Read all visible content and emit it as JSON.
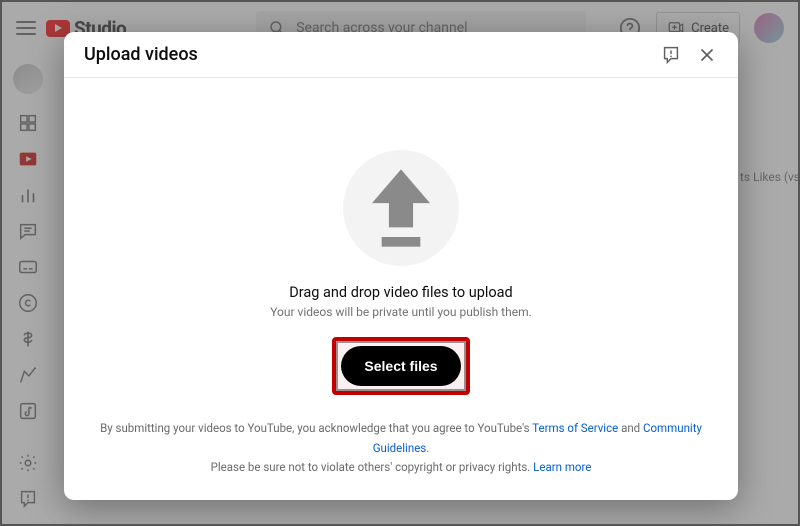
{
  "top": {
    "brand": "Studio",
    "search_placeholder": "Search across your channel",
    "create_label": "Create"
  },
  "bg_hint": "ts        Likes (vs",
  "modal": {
    "title": "Upload videos",
    "drop_title": "Drag and drop video files to upload",
    "drop_sub": "Your videos will be private until you publish them.",
    "select_label": "Select files",
    "legal": {
      "prefix": "By submitting your videos to YouTube, you acknowledge that you agree to YouTube's ",
      "tos": "Terms of Service",
      "and": " and ",
      "guidelines": "Community Guidelines",
      "suffix": ".",
      "line2_prefix": "Please be sure not to violate others' copyright or privacy rights. ",
      "learn": "Learn more"
    }
  }
}
